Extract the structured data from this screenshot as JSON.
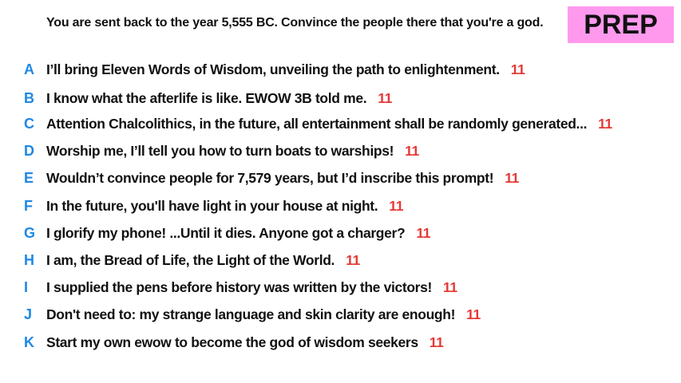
{
  "prompt": "You are sent back to the year 5,555 BC. Convince the people there that you're a god.",
  "badge": "PREP",
  "colors": {
    "letter": "#1e88e5",
    "score": "#e53935",
    "badge_bg": "#ff99ee"
  },
  "responses": [
    {
      "letter": "A",
      "text": "I’ll bring Eleven Words of Wisdom, unveiling the path to enlightenment.",
      "score": "11"
    },
    {
      "letter": "B",
      "text": "I know what the afterlife is like. EWOW 3B told me.",
      "score": "11"
    },
    {
      "letter": "C",
      "text": "Attention Chalcolithics, in the future, all entertainment shall be randomly generated...",
      "score": "11"
    },
    {
      "letter": "D",
      "text": "Worship me, I’ll tell you how to turn boats to warships!",
      "score": "11"
    },
    {
      "letter": "E",
      "text": "Wouldn’t convince people for 7,579 years, but I’d inscribe this prompt!",
      "score": "11"
    },
    {
      "letter": "F",
      "text": "In the future, you'll have light in your house at night.",
      "score": "11"
    },
    {
      "letter": "G",
      "text": "I glorify my phone! ...Until it dies. Anyone got a charger?",
      "score": "11"
    },
    {
      "letter": "H",
      "text": "I am, the Bread of Life, the Light of the World.",
      "score": "11"
    },
    {
      "letter": "I",
      "text": "I supplied the pens before history was written by the victors!",
      "score": "11"
    },
    {
      "letter": "J",
      "text": "Don't need to: my strange language and skin clarity are enough!",
      "score": "11"
    },
    {
      "letter": "K",
      "text": "Start my own ewow to become the god of wisdom seekers",
      "score": "11"
    }
  ]
}
